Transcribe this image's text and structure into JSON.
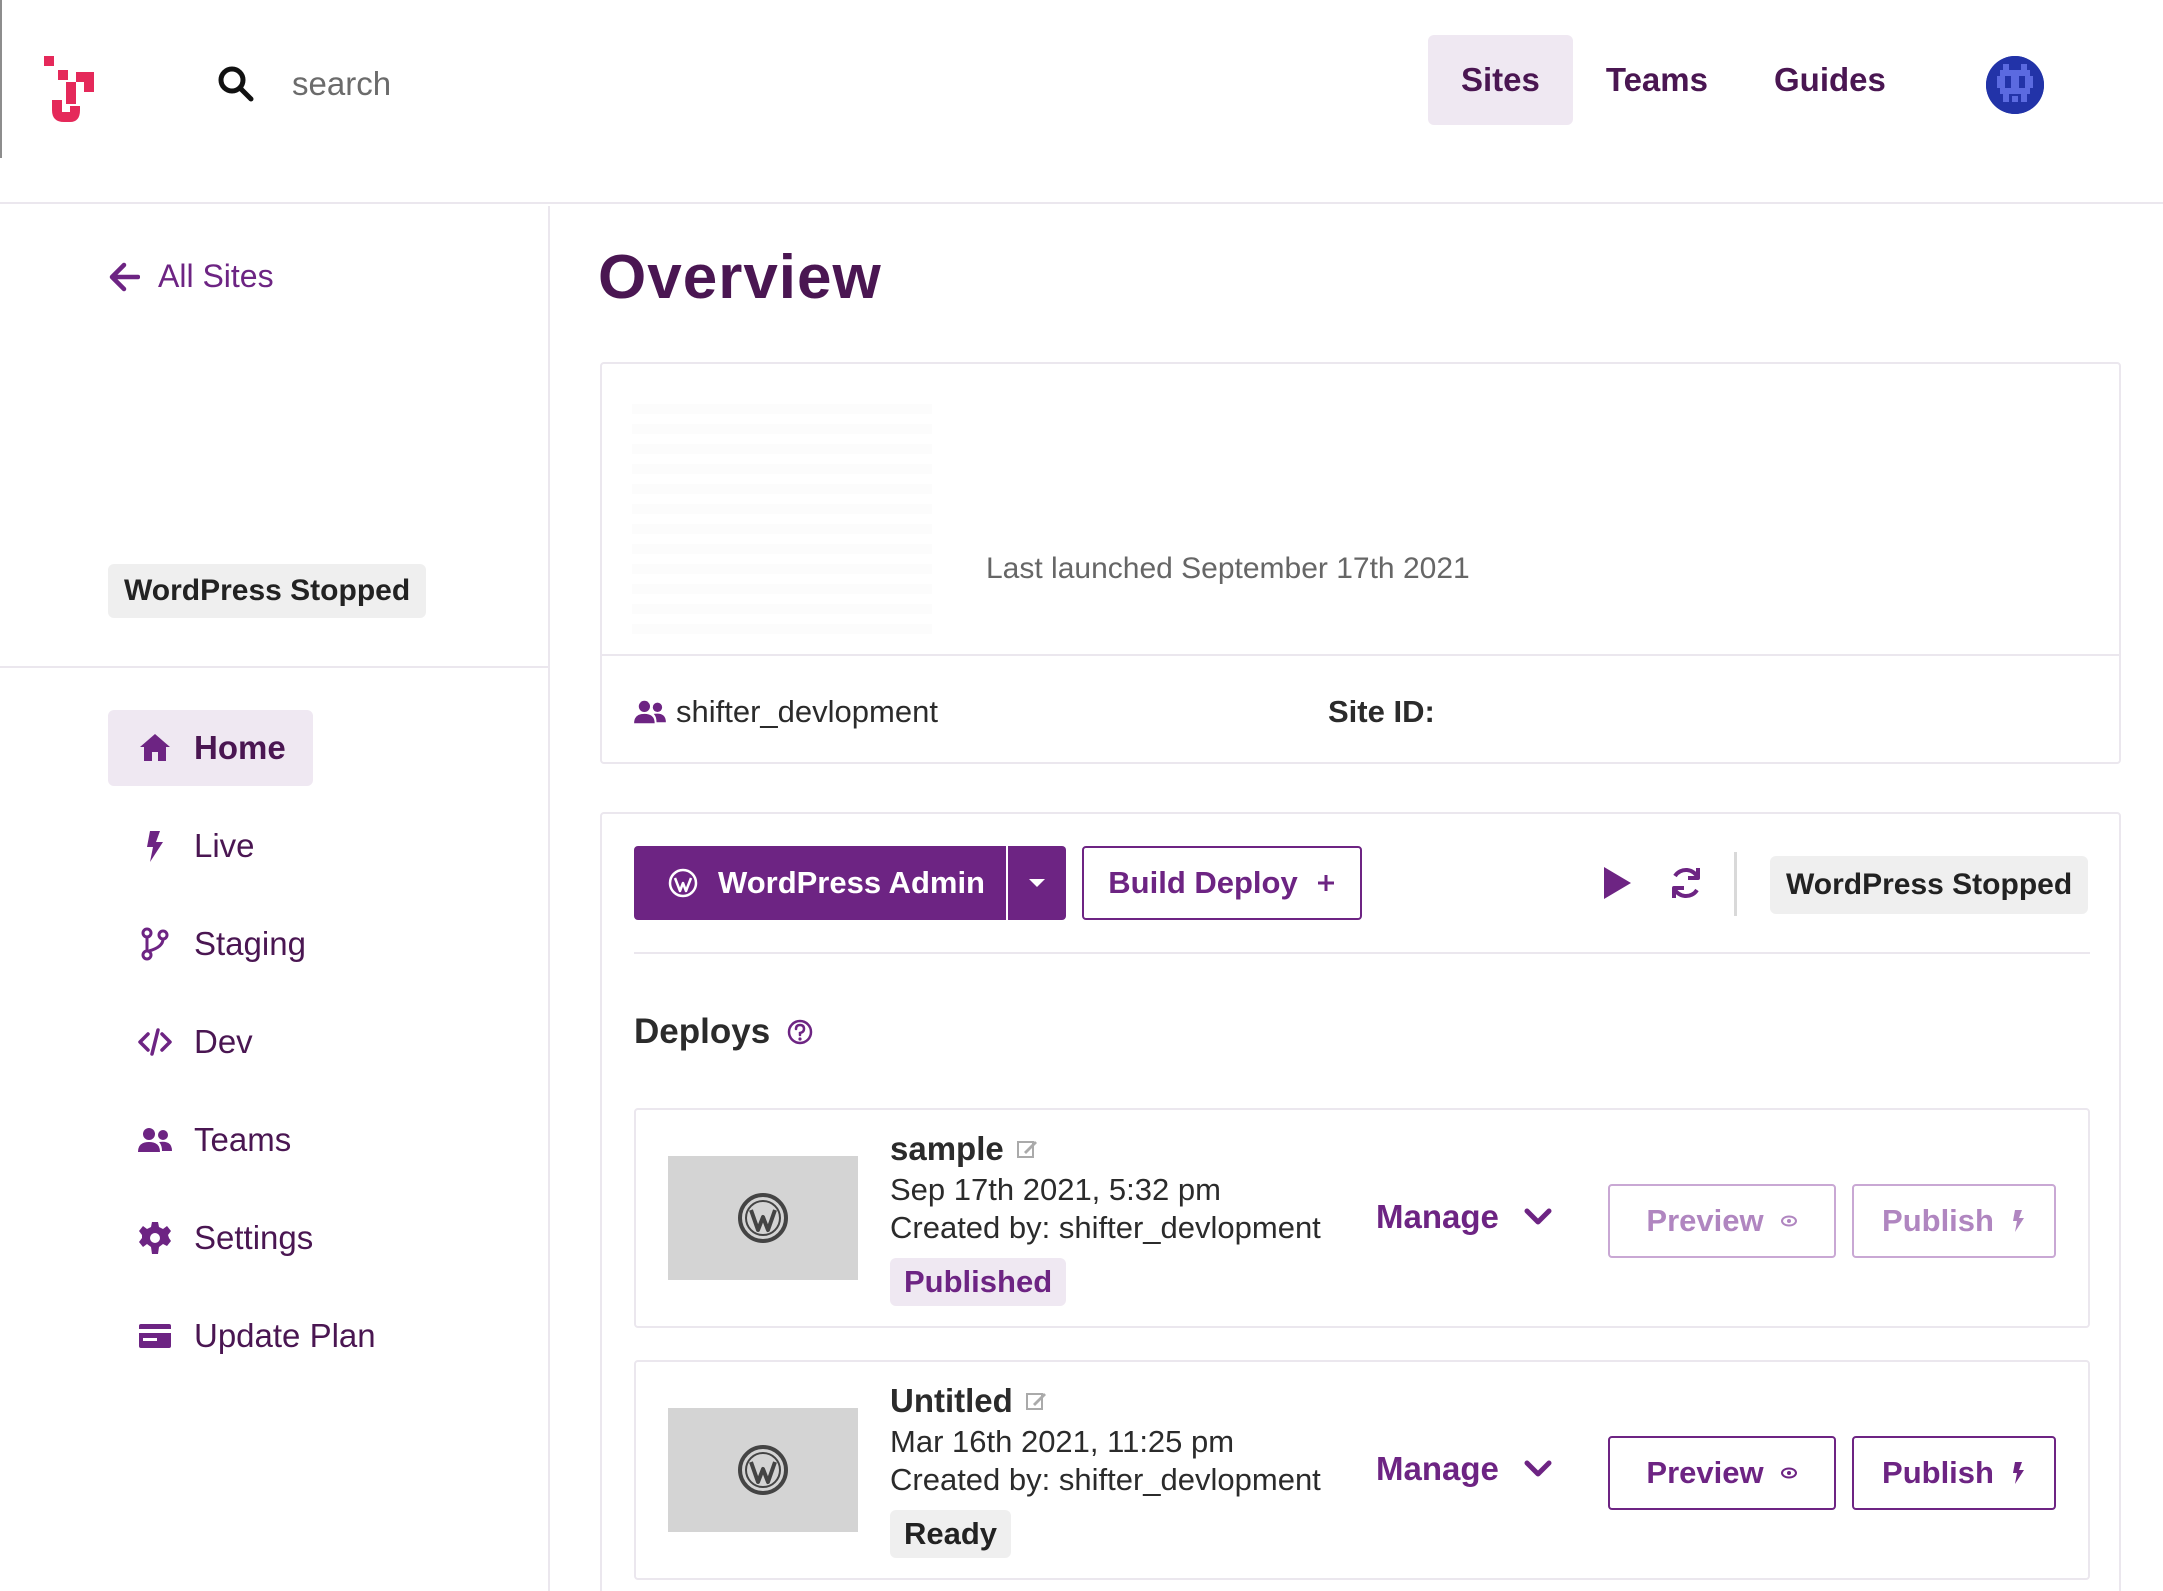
{
  "topbar": {
    "search_placeholder": "search",
    "nav": [
      {
        "label": "Sites",
        "active": true
      },
      {
        "label": "Teams",
        "active": false
      },
      {
        "label": "Guides",
        "active": false
      }
    ],
    "avatar_icon": "pixel-avatar-icon"
  },
  "sidebar": {
    "back_label": "All Sites",
    "status": "WordPress Stopped",
    "nav": [
      {
        "label": "Home",
        "icon": "home-icon",
        "active": true
      },
      {
        "label": "Live",
        "icon": "bolt-icon"
      },
      {
        "label": "Staging",
        "icon": "branch-icon"
      },
      {
        "label": "Dev",
        "icon": "code-icon"
      },
      {
        "label": "Teams",
        "icon": "users-icon"
      },
      {
        "label": "Settings",
        "icon": "gear-icon"
      },
      {
        "label": "Update Plan",
        "icon": "credit-card-icon"
      }
    ]
  },
  "main": {
    "title": "Overview",
    "site_card": {
      "last_launched": "Last launched September 17th 2021",
      "team": "shifter_devlopment",
      "site_id_label": "Site ID:"
    },
    "toolbar": {
      "wp_admin_label": "WordPress Admin",
      "build_deploy_label": "Build Deploy",
      "status": "WordPress Stopped"
    },
    "deploys": {
      "heading": "Deploys",
      "items": [
        {
          "name": "sample",
          "date": "Sep 17th 2021, 5:32 pm",
          "creator": "Created by: shifter_devlopment",
          "status": "Published",
          "manage_label": "Manage",
          "preview_label": "Preview",
          "publish_label": "Publish"
        },
        {
          "name": "Untitled",
          "date": "Mar 16th 2021, 11:25 pm",
          "creator": "Created by: shifter_devlopment",
          "status": "Ready",
          "manage_label": "Manage",
          "preview_label": "Preview",
          "publish_label": "Publish"
        }
      ]
    }
  },
  "colors": {
    "brand": "#6d2483",
    "brand_dark": "#4a1652",
    "brand_light": "#efe8f2",
    "logo_red": "#e5295a"
  }
}
